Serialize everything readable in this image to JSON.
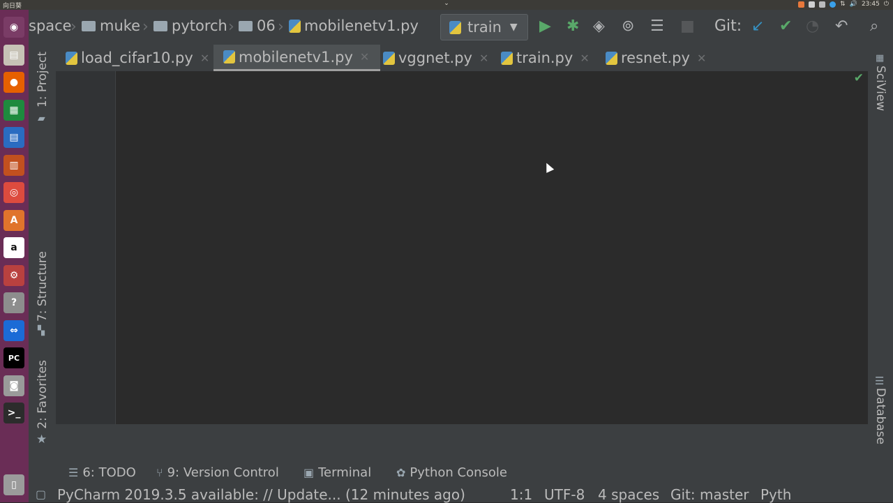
{
  "system_bar": {
    "app_name": "向日葵",
    "time": "23:45"
  },
  "launcher": {
    "items": [
      {
        "icon": "ubuntu-dash-icon",
        "color": "#7a3c66"
      },
      {
        "icon": "files-icon",
        "color": "#c7c2b6"
      },
      {
        "icon": "firefox-icon",
        "color": "#e66000"
      },
      {
        "icon": "libreoffice-calc-icon",
        "color": "#1e8a3e"
      },
      {
        "icon": "libreoffice-writer-icon",
        "color": "#2a6cc1"
      },
      {
        "icon": "libreoffice-impress-icon",
        "color": "#c2501f"
      },
      {
        "icon": "chrome-icon",
        "color": "#dd4b3e"
      },
      {
        "icon": "software-center-icon",
        "color": "#e0742c"
      },
      {
        "icon": "amazon-icon",
        "color": "#ffffff"
      },
      {
        "icon": "settings-icon",
        "color": "#b9413f"
      },
      {
        "icon": "help-icon",
        "color": "#8d8d8d"
      },
      {
        "icon": "teamviewer-icon",
        "color": "#1b6bd6"
      },
      {
        "icon": "pycharm-icon",
        "color": "#21d789"
      },
      {
        "icon": "screenshot-icon",
        "color": "#9a9a9a"
      },
      {
        "icon": "terminal-icon",
        "color": "#2c2c2c"
      },
      {
        "icon": "trash-icon",
        "color": "#9b9b9b"
      }
    ]
  },
  "navbar": {
    "breadcrumbs": [
      "space",
      "muke",
      "pytorch",
      "06",
      "mobilenetv1.py"
    ],
    "run_config": "train",
    "git_label": "Git:"
  },
  "tabs": [
    {
      "label": "load_cifar10.py",
      "active": false
    },
    {
      "label": "mobilenetv1.py",
      "active": true
    },
    {
      "label": "vggnet.py",
      "active": false
    },
    {
      "label": "train.py",
      "active": false
    },
    {
      "label": "resnet.py",
      "active": false
    }
  ],
  "left_tools": {
    "project": "1: Project",
    "structure": "7: Structure",
    "favorites": "2: Favorites"
  },
  "right_tools": {
    "sciview": "SciView",
    "database": "Database"
  },
  "bottom_tools": {
    "todo": "6: TODO",
    "version_control": "9: Version Control",
    "terminal": "Terminal",
    "python_console": "Python Console"
  },
  "status_bar": {
    "message": "PyCharm 2019.3.5 available: // Update... (12 minutes ago)",
    "position": "1:1",
    "encoding": "UTF-8",
    "indent": "4 spaces",
    "git_branch": "Git: master",
    "interpreter": "Pyth"
  },
  "colors": {
    "accent_run": "#59a869",
    "git_update": "#3592c4",
    "git_commit": "#59a869"
  }
}
